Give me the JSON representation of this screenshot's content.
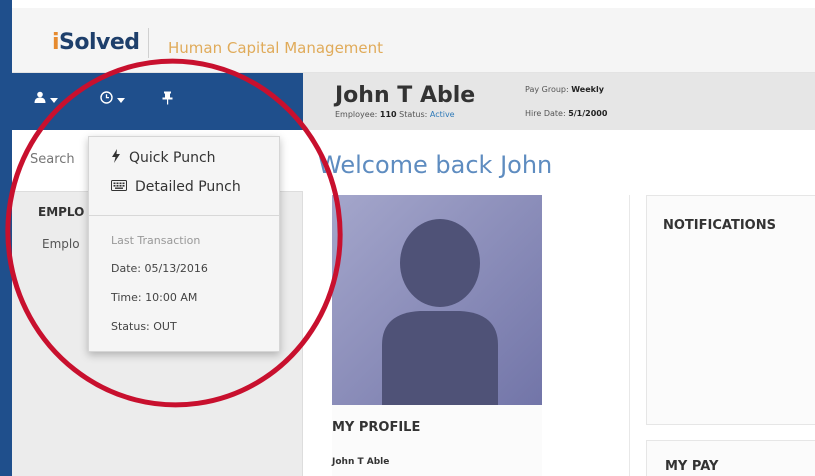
{
  "header": {
    "logo": {
      "prefix": "i",
      "main": "Solved"
    },
    "subtitle": "Human Capital Management"
  },
  "nav": {
    "user_icon": "user-icon",
    "clock_icon": "clock-icon",
    "pin_icon": "pin-icon"
  },
  "employee": {
    "name": "John T Able",
    "employee_label": "Employee:",
    "employee_number": "110",
    "status_label": "Status:",
    "status": "Active",
    "pay_group_label": "Pay Group:",
    "pay_group": "Weekly",
    "hire_date_label": "Hire Date:",
    "hire_date": "5/1/2000"
  },
  "sidebar": {
    "search_placeholder": "Search",
    "heading": "EMPLO",
    "item": "Emplo"
  },
  "punch_menu": {
    "quick_punch": "Quick Punch",
    "detailed_punch": "Detailed Punch",
    "last_transaction_label": "Last Transaction",
    "date": "Date: 05/13/2016",
    "time": "Time: 10:00 AM",
    "status": "Status: OUT"
  },
  "main": {
    "welcome": "Welcome back John",
    "profile_title": "MY PROFILE",
    "profile_name": "John T Able",
    "notifications_title": "NOTIFICATIONS",
    "pay_title": "MY PAY"
  },
  "colors": {
    "brand_blue": "#1f4f8c",
    "accent_orange": "#e68a2e",
    "welcome_blue": "#5e8cc0",
    "annotation_red": "#c8102e"
  }
}
